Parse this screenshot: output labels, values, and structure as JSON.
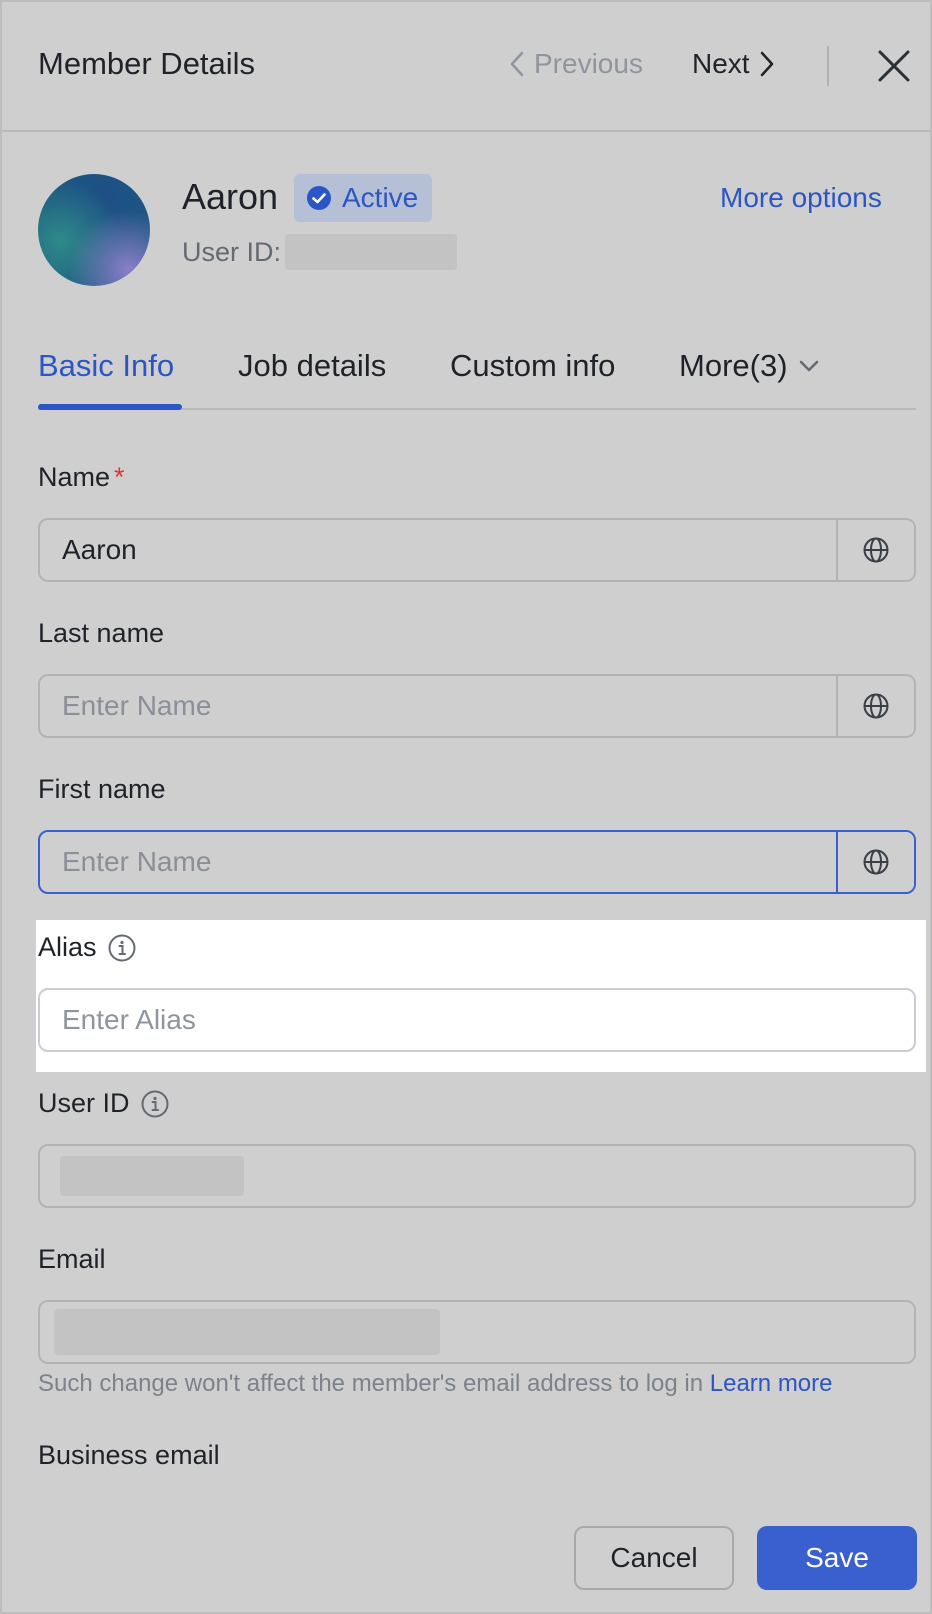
{
  "header": {
    "title": "Member Details",
    "previous_label": "Previous",
    "next_label": "Next"
  },
  "profile": {
    "name": "Aaron",
    "status": "Active",
    "user_id_label": "User ID:",
    "more_options": "More options"
  },
  "tabs": [
    {
      "label": "Basic Info",
      "active": true
    },
    {
      "label": "Job details",
      "active": false
    },
    {
      "label": "Custom info",
      "active": false
    },
    {
      "label": "More(3)",
      "active": false
    }
  ],
  "form": {
    "name": {
      "label": "Name",
      "required_mark": "*",
      "value": "Aaron"
    },
    "last_name": {
      "label": "Last name",
      "placeholder": "Enter Name"
    },
    "first_name": {
      "label": "First name",
      "placeholder": "Enter Name"
    },
    "alias": {
      "label": "Alias",
      "placeholder": "Enter Alias"
    },
    "user_id": {
      "label": "User ID"
    },
    "email": {
      "label": "Email",
      "hint": "Such change won't affect the member's email address to log in",
      "hint_link": "Learn more"
    },
    "business_email": {
      "label": "Business email"
    }
  },
  "footer": {
    "cancel_label": "Cancel",
    "save_label": "Save"
  },
  "colors": {
    "accent": "#3a5fcf",
    "link": "#2c55c5",
    "required": "#d83931",
    "overlay": "#cfcfcf",
    "highlight": "#ffffff"
  },
  "icons": {
    "prev": "chevron-left-icon",
    "next": "chevron-right-icon",
    "close": "close-icon",
    "status": "check-circle-icon",
    "tab_more": "chevron-down-icon",
    "language": "globe-icon",
    "info": "info-icon"
  }
}
